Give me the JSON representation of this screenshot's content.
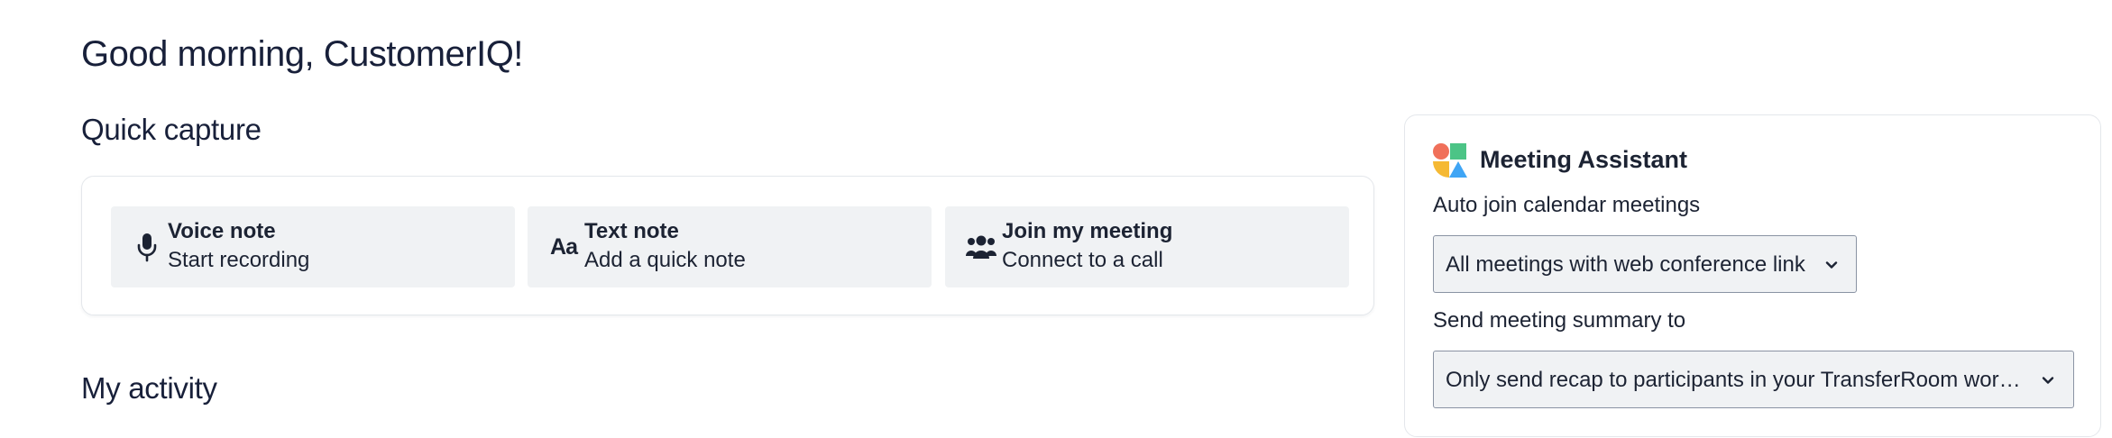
{
  "greeting": "Good morning, CustomerIQ!",
  "quick_capture": {
    "title": "Quick capture",
    "items": [
      {
        "title": "Voice note",
        "subtitle": "Start recording",
        "icon": "microphone-icon"
      },
      {
        "title": "Text note",
        "subtitle": "Add a quick note",
        "icon": "text-aa-icon",
        "glyph": "Aa"
      },
      {
        "title": "Join my meeting",
        "subtitle": "Connect to a call",
        "icon": "people-group-icon"
      }
    ]
  },
  "activity": {
    "title": "My activity"
  },
  "meeting_assistant": {
    "title": "Meeting Assistant",
    "logo": "meeting-assistant-logo",
    "auto_join": {
      "label": "Auto join calendar meetings",
      "value": "All meetings with web conference link"
    },
    "summary": {
      "label": "Send meeting summary to",
      "value": "Only send recap to participants in your TransferRoom work..."
    }
  },
  "colors": {
    "text": "#1c2333",
    "button_bg": "#f0f2f4",
    "card_border": "#e4e7eb",
    "logo_red": "#f0705a",
    "logo_green": "#4cc486",
    "logo_yellow": "#f5b934",
    "logo_blue": "#3fa5f5"
  }
}
